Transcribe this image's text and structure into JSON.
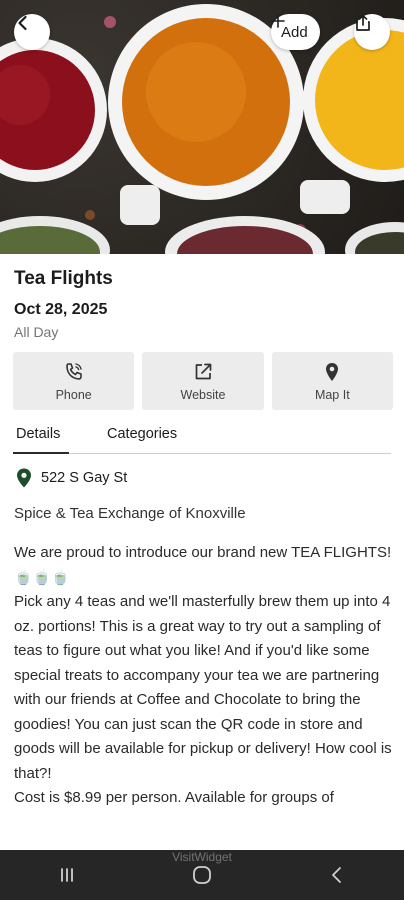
{
  "header": {
    "add_label": "Add",
    "back_icon": "chevron-left-icon",
    "share_icon": "share-icon"
  },
  "event": {
    "title": "Tea Flights",
    "date": "Oct 28, 2025",
    "time": "All Day"
  },
  "actions": [
    {
      "label": "Phone",
      "icon": "phone-icon"
    },
    {
      "label": "Website",
      "icon": "external-link-icon"
    },
    {
      "label": "Map It",
      "icon": "map-pin-icon"
    }
  ],
  "tabs": [
    {
      "label": "Details",
      "active": true
    },
    {
      "label": "Categories",
      "active": false
    }
  ],
  "details": {
    "address": "522 S Gay St",
    "venue": "Spice & Tea Exchange of Knoxville",
    "description": [
      "We are proud to introduce our brand new TEA FLIGHTS! 🍵🍵🍵",
      "Pick any 4 teas and we'll masterfully brew them up into 4 oz. portions! This is a great way to try out a sampling of teas to figure out what you like! And if you'd like some special treats to accompany your tea we are partnering with our friends at Coffee and Chocolate to bring the goodies! You can just scan the QR code in store and goods will be available for pickup or delivery! How cool is that?!",
      "Cost is $8.99 per person. Available for groups of"
    ]
  },
  "watermark": "VisitWidget",
  "colors": {
    "pin_green": "#1e4d2b",
    "button_bg": "#ececec",
    "nav_bg": "#262626"
  }
}
